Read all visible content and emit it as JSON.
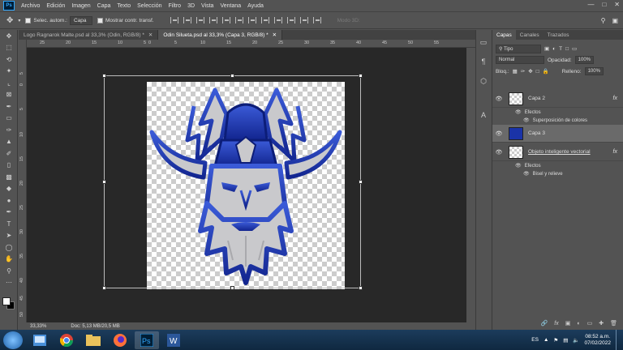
{
  "menubar": {
    "app_logo": "Ps",
    "items": [
      "Archivo",
      "Edición",
      "Imagen",
      "Capa",
      "Texto",
      "Selección",
      "Filtro",
      "3D",
      "Vista",
      "Ventana",
      "Ayuda"
    ]
  },
  "options": {
    "auto_select_label": "Selec. autom.:",
    "auto_select_value": "Capa",
    "show_transform_label": "Mostrar contr. transf.",
    "mode3d_label": "Modo 3D:"
  },
  "tabs": [
    {
      "label": "Logo Ragnarok Malte.psd al 33,3% (Odin, RGB/8) *",
      "active": false
    },
    {
      "label": "Odin Silueta.psd al 33,3% (Capa 3, RGB/8) *",
      "active": true
    }
  ],
  "ruler_top": [
    "25",
    "20",
    "15",
    "10",
    "5",
    "0",
    "5",
    "10",
    "15",
    "20",
    "25",
    "30",
    "35",
    "40",
    "45",
    "50",
    "55"
  ],
  "ruler_left": [
    "5",
    "0",
    "5",
    "10",
    "15",
    "20",
    "25",
    "30",
    "35",
    "40",
    "45",
    "50"
  ],
  "status": {
    "zoom": "33,33%",
    "doc": "Doc: 5,13 MB/20,5 MB"
  },
  "layers_panel": {
    "tabs": [
      "Capas",
      "Canales",
      "Trazados"
    ],
    "filter_label": "Tipo",
    "blend_mode": "Normal",
    "opacity_label": "Opacidad:",
    "opacity_value": "100%",
    "lock_label": "Bloq.:",
    "fill_label": "Relleno:",
    "fill_value": "100%",
    "layers": [
      {
        "name": "Capa 2",
        "fx": true,
        "selected": false
      },
      {
        "name": "Capa 3",
        "fx": false,
        "selected": true
      },
      {
        "name": "Objeto inteligente vectorial",
        "fx": true,
        "selected": false
      }
    ],
    "effects_label": "Efectos",
    "effect_capa2": "Superposición de colores",
    "effect_objeto": "Bisel y relieve",
    "fx_label": "fx"
  },
  "taskbar": {
    "language": "ES",
    "time": "08:52 a.m.",
    "date": "07/02/2022",
    "apps": [
      "explorer",
      "chrome",
      "explorer-folder",
      "firefox",
      "photoshop",
      "word"
    ]
  },
  "colors": {
    "logo_blue": "#1a33a8",
    "logo_gray": "#c9c9cc",
    "accent": "#31a8ff"
  }
}
